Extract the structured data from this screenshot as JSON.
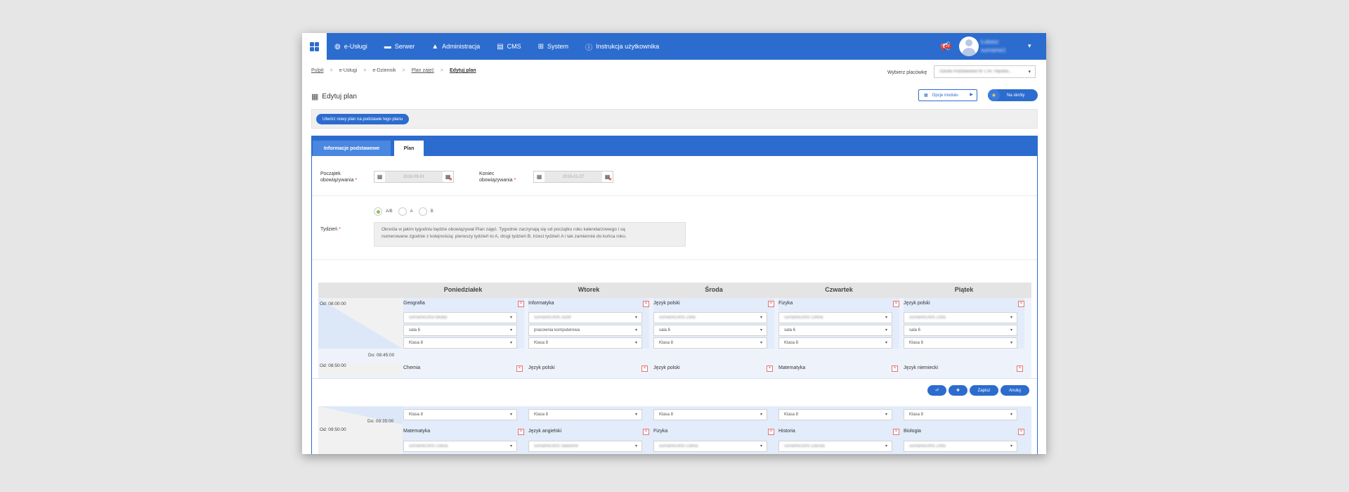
{
  "nav": {
    "items": [
      {
        "icon": "globe-icon",
        "glyph": "◍",
        "label": "e-Usługi"
      },
      {
        "icon": "server-icon",
        "glyph": "▬",
        "label": "Serwer"
      },
      {
        "icon": "admin-icon",
        "glyph": "▲",
        "label": "Administracja"
      },
      {
        "icon": "cms-icon",
        "glyph": "▤",
        "label": "CMS"
      },
      {
        "icon": "windows-icon",
        "glyph": "⊞",
        "label": "System"
      },
      {
        "icon": "info-icon",
        "glyph": "ⓘ",
        "label": "Instrukcja użytkownika"
      }
    ],
    "notification_count": "20",
    "user_name_line1": "Łukasz",
    "user_name_line2": "surname1"
  },
  "breadcrumb": [
    "Pulpit",
    "e-Usługi",
    "e-Dziennik",
    "Plan zajęć",
    "Edytuj plan"
  ],
  "facility": {
    "label": "Wybierz placówkę",
    "value": "Szkoła Podstawowa Nr 1 im. Hipolita..."
  },
  "page": {
    "title": "Edytuj plan",
    "options_label": "Opcje modułu",
    "shortcuts_label": "Na skróty",
    "create_new_label": "Utwórz nowy plan na podstawie tego planu"
  },
  "tabs": {
    "basic": "Informacje podstawowe",
    "plan": "Plan"
  },
  "form": {
    "start_label_1": "Początek",
    "start_label_2": "obowiązywania",
    "start_value": "2018-09-01",
    "end_label_1": "Koniec",
    "end_label_2": "obowiązywania",
    "end_value": "2019-01-27",
    "required_mark": "*",
    "week_label": "Tydzień",
    "week_options": [
      "A/B",
      "A",
      "B"
    ],
    "week_selected": "A/B",
    "hint_line1": "Określa w jakim tygodniu będzie obowiązywał Plan zajęć. Tygodnie zaczynają się od początku roku kalendarzowego i są",
    "hint_line2": "numerowane zgodnie z kolejnością: pierwszy tydzień to A, drugi tydzień B, trzeci tydzień A i tak zamiennie do końca roku."
  },
  "timetable": {
    "days": [
      "Poniedziałek",
      "Wtorek",
      "Środa",
      "Czwartek",
      "Piątek"
    ],
    "slot1": {
      "from": "Od: 08:00:00",
      "to": "Do: 08:45:00",
      "cells": [
        {
          "subject": "Geografia",
          "teacher": "surname1403 Beata",
          "room": "sala 6",
          "class": "Klasa 8"
        },
        {
          "subject": "Informatyka",
          "teacher": "surname1406 Józef",
          "room": "pracownia komputerowa",
          "class": "Klasa 8"
        },
        {
          "subject": "Język polski",
          "teacher": "surname1405 Zofia",
          "room": "sala 6",
          "class": "Klasa 8"
        },
        {
          "subject": "Fizyka",
          "teacher": "surname1405 Celina",
          "room": "sala 6",
          "class": "Klasa 8"
        },
        {
          "subject": "Język polski",
          "teacher": "surname1405 Zofia",
          "room": "sala 6",
          "class": "Klasa 8"
        }
      ]
    },
    "slot2": {
      "from": "Od: 08:50:00",
      "to": "Do: 09:35:00",
      "subjects": [
        "Chemia",
        "Język polski",
        "Język polski",
        "Matematyka",
        "Język niemiecki"
      ],
      "classes": [
        "Klasa 8",
        "Klasa 8",
        "Klasa 8",
        "Klasa 8",
        "Klasa 8"
      ]
    },
    "slot3": {
      "from": "Od: 09:50:00",
      "subjects": [
        "Matematyka",
        "Język angielski",
        "Fizyka",
        "Historia",
        "Biologia"
      ],
      "teachers": [
        "surname1405 Celina",
        "surname1403 Sławomir",
        "surname1405 Celina",
        "surname1405 Danuta",
        "surname1405 Zofia"
      ]
    },
    "remove_glyph": "×"
  },
  "actions": {
    "back_glyph": "⏎",
    "add_glyph": "✚",
    "save": "Zapisz",
    "cancel": "Anuluj"
  },
  "colors": {
    "primary": "#2c6ccf",
    "danger": "#e23030",
    "selected_radio": "#8bc34a"
  }
}
